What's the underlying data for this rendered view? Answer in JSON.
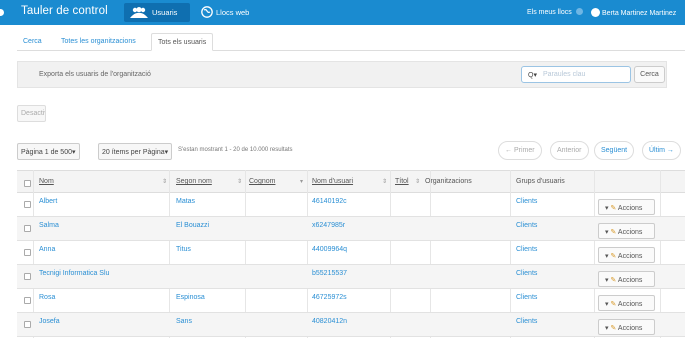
{
  "header": {
    "brand": "Tauler de control",
    "nav_users": "Usuaris",
    "nav_web": "Llocs web",
    "my_sites": "Els meus llocs",
    "user_name": "Berta Martinez Martinez"
  },
  "tabs": [
    "Cerca",
    "Totes les organitzacions",
    "Tots els usuaris"
  ],
  "export": {
    "text": "Exporta els usuaris de l'organització",
    "search_placeholder": "Paraules clau",
    "search_button": "Cerca"
  },
  "deactivate_button": "Desactivat",
  "pager": {
    "page_button": "Pàgina 1 de 500",
    "per_page_button": "20 ítems per Pàgina",
    "showing": "S'estan mostrant 1 - 20 de 10.000 resultats",
    "first": "← Primer",
    "previous": "Anterior",
    "next": "Següent",
    "last": "Últim →"
  },
  "table": {
    "columns": [
      "Nom",
      "Segon nom",
      "Cognom",
      "Nom d'usuari",
      "Títol",
      "Organitzacions",
      "Grups d'usuaris"
    ],
    "action_label": "Accions",
    "rows": [
      {
        "nom": "Albert",
        "segon": "Matas",
        "cognom": "",
        "usuari": "46140192c",
        "titol": "",
        "org": "",
        "grup": "Clients"
      },
      {
        "nom": "Salma",
        "segon": "El Bouazzi",
        "cognom": "",
        "usuari": "x6247985r",
        "titol": "",
        "org": "",
        "grup": "Clients"
      },
      {
        "nom": "Anna",
        "segon": "Titus",
        "cognom": "",
        "usuari": "44009964q",
        "titol": "",
        "org": "",
        "grup": "Clients"
      },
      {
        "nom": "Tecnigi Informatica Slu",
        "segon": "",
        "cognom": "",
        "usuari": "b55215537",
        "titol": "",
        "org": "",
        "grup": "Clients"
      },
      {
        "nom": "Rosa",
        "segon": "Espinosa",
        "cognom": "",
        "usuari": "46725972s",
        "titol": "",
        "org": "",
        "grup": "Clients"
      },
      {
        "nom": "Josefa",
        "segon": "Sans",
        "cognom": "",
        "usuari": "40820412n",
        "titol": "",
        "org": "",
        "grup": "Clients"
      }
    ]
  },
  "colors": {
    "topbar": "#1a8bd0",
    "link": "#2a8fd4"
  },
  "icons": {
    "users": "users-icon",
    "web": "globe-icon",
    "search": "search-icon",
    "pencil": "pencil-icon"
  }
}
